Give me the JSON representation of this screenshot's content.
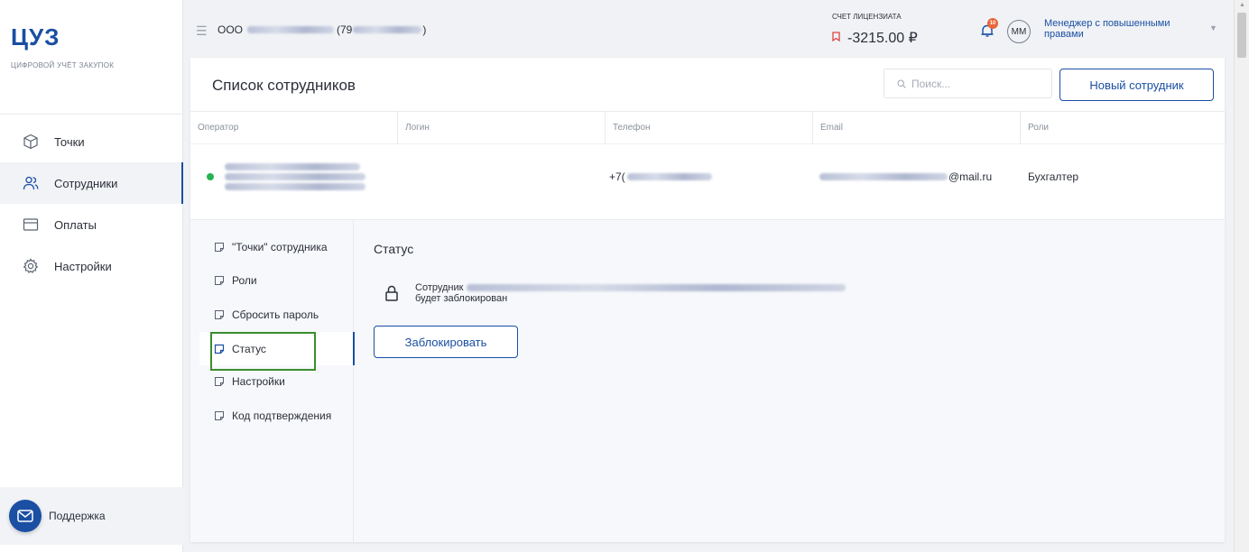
{
  "sidebar": {
    "logo": "ЦУЗ",
    "logo_subtitle": "цифровой учёт закупок",
    "items": [
      {
        "label": "Точки",
        "icon": "cube-icon"
      },
      {
        "label": "Сотрудники",
        "icon": "users-icon"
      },
      {
        "label": "Оплаты",
        "icon": "card-icon"
      },
      {
        "label": "Настройки",
        "icon": "gear-icon"
      }
    ],
    "active_index": 1,
    "support_label": "Поддержка"
  },
  "topbar": {
    "org_prefix": "ООО",
    "org_suffix_open": "(79",
    "org_suffix_close": ")",
    "account_label": "СЧЕТ ЛИЦЕНЗИАТА",
    "account_value": "-3215.00 ₽",
    "notifications_count": "10",
    "avatar_initials": "ММ",
    "role": "Менеджер с повышенными правами"
  },
  "main": {
    "title": "Список сотрудников",
    "search_placeholder": "Поиск...",
    "new_button": "Новый сотрудник",
    "columns": [
      "Оператор",
      "Логин",
      "Телефон",
      "Email",
      "Роли"
    ],
    "row": {
      "phone_prefix": "+7(",
      "email_suffix": "@mail.ru",
      "role": "Бухгалтер"
    }
  },
  "detail": {
    "menu": [
      "\"Точки\" сотрудника",
      "Роли",
      "Сбросить пароль",
      "Статус",
      "Настройки",
      "Код подтверждения"
    ],
    "active_index": 3,
    "title": "Статус",
    "employee_prefix": "Сотрудник",
    "will_be_blocked": "будет заблокирован",
    "block_button": "Заблокировать"
  },
  "colors": {
    "brand": "#1a4fa3",
    "status_active": "#27b34f",
    "negative": "#e04343",
    "highlight": "#3b8d2e"
  }
}
